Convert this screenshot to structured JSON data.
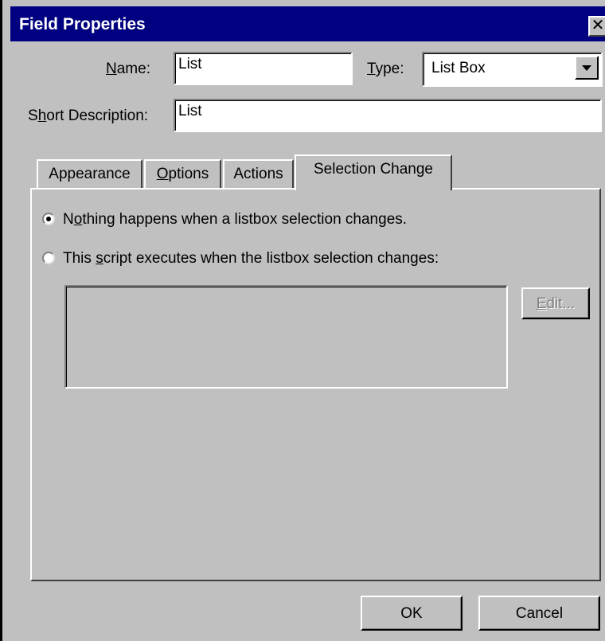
{
  "window": {
    "title": "Field Properties",
    "close_glyph": "✕"
  },
  "form": {
    "name_label_prefix": "",
    "name_label_accel": "N",
    "name_label_rest": "ame:",
    "name_value": "List",
    "type_label_accel": "T",
    "type_label_rest": "ype:",
    "type_value": "List Box",
    "desc_label_prefix": "S",
    "desc_label_accel": "h",
    "desc_label_rest": "ort Description:",
    "desc_value": "List"
  },
  "tabs": [
    {
      "label": "Appearance",
      "active": false
    },
    {
      "label": "Options",
      "accel": "O",
      "rest": "ptions",
      "active": false
    },
    {
      "label": "Actions",
      "active": false
    },
    {
      "label": "Selection Change",
      "active": true
    }
  ],
  "selection_change": {
    "option1_prefix": "N",
    "option1_accel": "o",
    "option1_rest": "thing happens when a listbox selection changes.",
    "option1_selected": true,
    "option2_prefix": "This ",
    "option2_accel": "s",
    "option2_rest": "cript executes when the listbox selection changes:",
    "option2_selected": false,
    "script_text": "",
    "edit_accel": "E",
    "edit_rest": "dit..."
  },
  "buttons": {
    "ok": "OK",
    "cancel": "Cancel"
  }
}
